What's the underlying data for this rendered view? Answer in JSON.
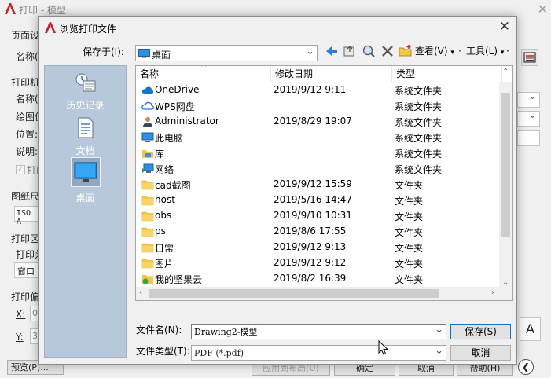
{
  "background_dialog": {
    "title": "打印 - 模型",
    "labels": {
      "page_setup": "页面设",
      "name1": "名称(",
      "printer": "打印机",
      "name2": "名称(",
      "plotter": "绘图仪",
      "location": "位置:",
      "description": "说明:",
      "print_to_file": "打印",
      "paper_size": "图纸尺",
      "paper_size_value": "ISO A",
      "plot_area": "打印区",
      "plot_what": "打印范",
      "plot_what_value": "窗口",
      "plot_offset": "打印偏",
      "x": "X:",
      "x_value": "0",
      "y": "Y:",
      "y_value": "3"
    },
    "buttons": {
      "preview": "预览(P)...",
      "apply": "应用到布局(U)",
      "ok": "确定",
      "cancel": "取消",
      "help": "帮助(H)"
    }
  },
  "dialog": {
    "title": "浏览打印文件",
    "save_in_label": "保存于(I):",
    "save_in_value": "桌面",
    "toolbar": {
      "views_label": "查看(V)",
      "tools_label": "工具(L)"
    },
    "places": [
      {
        "label": "历史记录",
        "icon": "history-icon"
      },
      {
        "label": "文档",
        "icon": "documents-icon"
      },
      {
        "label": "桌面",
        "icon": "desktop-icon",
        "selected": true
      }
    ],
    "columns": {
      "name": "名称",
      "modified": "修改日期",
      "type": "类型"
    },
    "files": [
      {
        "name": "OneDrive",
        "date": "2019/9/12 9:11",
        "type": "系统文件夹",
        "icon": "cloud-icon"
      },
      {
        "name": "WPS网盘",
        "date": "",
        "type": "系统文件夹",
        "icon": "cloud-outline-icon"
      },
      {
        "name": "Administrator",
        "date": "2019/8/29 19:07",
        "type": "系统文件夹",
        "icon": "user-icon"
      },
      {
        "name": "此电脑",
        "date": "",
        "type": "系统文件夹",
        "icon": "computer-icon"
      },
      {
        "name": "库",
        "date": "",
        "type": "系统文件夹",
        "icon": "library-icon"
      },
      {
        "name": "网络",
        "date": "",
        "type": "系统文件夹",
        "icon": "network-icon"
      },
      {
        "name": "cad截图",
        "date": "2019/9/12 15:59",
        "type": "文件夹",
        "icon": "folder-icon"
      },
      {
        "name": "host",
        "date": "2019/5/16 14:47",
        "type": "文件夹",
        "icon": "folder-icon"
      },
      {
        "name": "obs",
        "date": "2019/9/10 10:31",
        "type": "文件夹",
        "icon": "folder-icon"
      },
      {
        "name": "ps",
        "date": "2019/8/6 17:55",
        "type": "文件夹",
        "icon": "folder-icon"
      },
      {
        "name": "日常",
        "date": "2019/9/12 9:13",
        "type": "文件夹",
        "icon": "folder-icon"
      },
      {
        "name": "图片",
        "date": "2019/9/12 9:12",
        "type": "文件夹",
        "icon": "folder-icon"
      },
      {
        "name": "我的坚果云",
        "date": "2019/8/2 16:39",
        "type": "文件夹",
        "icon": "nutstore-folder-icon"
      }
    ],
    "filename_label": "文件名(N):",
    "filename_value": "Drawing2-模型",
    "filetype_label": "文件类型(T):",
    "filetype_value": "PDF (*.pdf)",
    "save_button": "保存(S)",
    "cancel_button": "取消"
  },
  "colors": {
    "places_bg": "#b7c8db",
    "autocad_red": "#c8202f",
    "folder_yellow": "#f3c846",
    "onedrive_blue": "#1a73c9"
  }
}
